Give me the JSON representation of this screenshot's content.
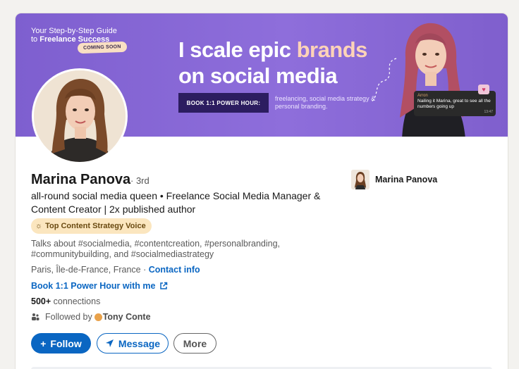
{
  "banner": {
    "guide_line1": "Your Step-by-Step Guide",
    "guide_line2_prefix": "to ",
    "guide_line2_bold": "Freelance Success",
    "coming_soon": "COMING SOON",
    "headline_line1_a": "I scale epic ",
    "headline_line1_b": "brands",
    "headline_line2": "on social media",
    "cta": "BOOK 1:1 POWER HOUR:",
    "cta_sub": "freelancing, social media strategy & personal branding.",
    "chat_sender": "Arron",
    "chat_text": "Nailing it Marina, great to see all the numbers going up",
    "chat_time": "13:47",
    "colors": {
      "background": "#8a6bd8",
      "accent": "#ffd3b8",
      "cta_bg": "#2c1d60"
    }
  },
  "profile": {
    "name": "Marina Panova",
    "degree": "· 3rd",
    "headline": "all-round social media queen • Freelance Social Media Manager & Content Creator | 2x published author",
    "badge": "Top Content Strategy Voice",
    "talks_about": "Talks about #socialmedia, #contentcreation, #personalbranding, #communitybuilding, and #socialmediastrategy",
    "location": "Paris, Île-de-France, France · ",
    "contact_info": "Contact info",
    "power_hour_link": "Book 1:1 Power Hour with me",
    "connections_count": "500+",
    "connections_label": " connections",
    "followed_by_prefix": "Followed by ",
    "followed_by_name": "Tony Conte"
  },
  "actions": {
    "follow": "Follow",
    "message": "Message",
    "more": "More"
  },
  "right": {
    "company_name": "Marina Panova"
  },
  "theme": {
    "link": "#0a66c2",
    "badge_bg": "#fbe6bf"
  }
}
